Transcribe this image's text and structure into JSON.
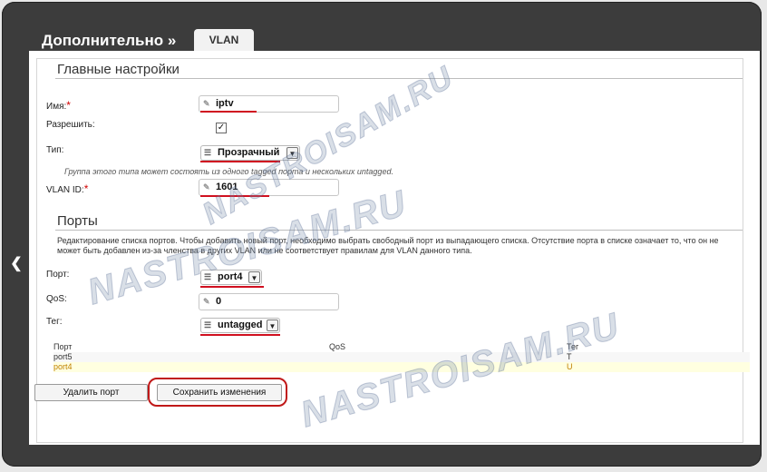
{
  "header": {
    "breadcrumb": "Дополнительно »",
    "tab_vlan": "VLAN"
  },
  "icons": {
    "back": "chevron-left-icon",
    "pencil": "pencil-icon",
    "list": "list-icon",
    "dropdown": "chevron-down-icon"
  },
  "colors": {
    "accent_underline": "#d01020",
    "highlight_row": "#ffffe0",
    "highlight_text": "#c08000"
  },
  "main": {
    "title": "Главные настройки",
    "name_label": "Имя:",
    "name_value": "iptv",
    "enable_label": "Разрешить:",
    "enable_checked": "✓",
    "type_label": "Тип:",
    "type_value": "Прозрачный",
    "type_hint": "Группа этого типа может состоять из одного tagged порта и нескольких untagged.",
    "vlanid_label": "VLAN ID:",
    "vlanid_value": "1601",
    "required_mark": "*"
  },
  "ports": {
    "title": "Порты",
    "description": "Редактирование списка портов. Чтобы добавить новый порт, необходимо выбрать свободный порт из выпадающего списка. Отсутствие порта в списке означает то, что он не может быть добавлен из-за членства в других VLAN или не соответствует правилам для VLAN данного типа.",
    "port_label": "Порт:",
    "port_value": "port4",
    "qos_label": "QoS:",
    "qos_value": "0",
    "tag_label": "Тег:",
    "tag_value": "untagged",
    "table": {
      "headers": [
        "Порт",
        "QoS",
        "Тег"
      ],
      "rows": [
        {
          "port": "port5",
          "qos": "",
          "tag": "T"
        },
        {
          "port": "port4",
          "qos": "",
          "tag": "U"
        }
      ]
    },
    "delete_button": "Удалить порт",
    "save_button": "Сохранить изменения"
  },
  "watermark": "NASTROISAM.RU"
}
